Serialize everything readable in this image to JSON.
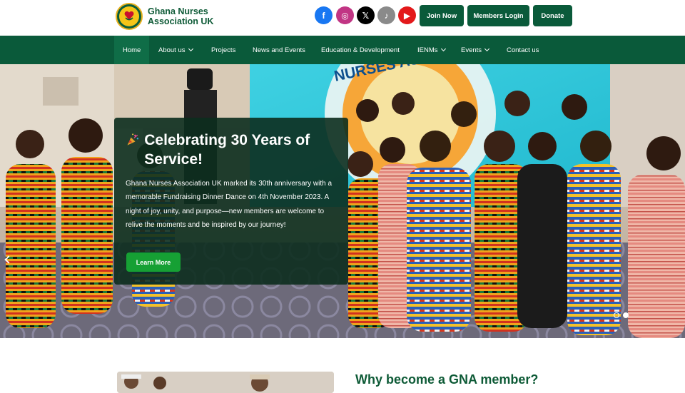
{
  "brand": {
    "line1": "Ghana Nurses",
    "line2": "Association UK",
    "color": "#0d5a36"
  },
  "social": [
    {
      "name": "facebook-icon",
      "glyph": "f",
      "color": "#1877f2"
    },
    {
      "name": "instagram-icon",
      "glyph": "◎",
      "color": "#c13584"
    },
    {
      "name": "x-icon",
      "glyph": "𝕏",
      "color": "#000000"
    },
    {
      "name": "tiktok-icon",
      "glyph": "♪",
      "color": "#8a8a8a"
    },
    {
      "name": "youtube-icon",
      "glyph": "▶",
      "color": "#e3191b"
    }
  ],
  "header_buttons": {
    "join": "Join Now",
    "login": "Members Login",
    "donate": "Donate"
  },
  "nav": [
    {
      "label": "Home",
      "dropdown": false,
      "active": true
    },
    {
      "label": "About us",
      "dropdown": true
    },
    {
      "label": "Projects",
      "dropdown": false
    },
    {
      "label": "News and Events",
      "dropdown": false
    },
    {
      "label": "Education & Development",
      "dropdown": false
    },
    {
      "label": "IENMs",
      "dropdown": true
    },
    {
      "label": "Events",
      "dropdown": true
    },
    {
      "label": "Contact us",
      "dropdown": false
    }
  ],
  "hero": {
    "banner_text": "NURSES ASSOCIATION",
    "title": "Celebrating 30 Years of Service!",
    "text": "Ghana Nurses Association UK marked its 30th anniversary with a memorable Fundraising Dinner Dance on 4th November 2023. A night of joy, unity, and purpose—new members are welcome to relive the moments and be inspired by our journey!",
    "button": "Learn More",
    "slides_count": 2,
    "active_slide": 2
  },
  "section": {
    "heading": "Why become a GNA member?"
  },
  "colors": {
    "primary": "#0a5a3a",
    "accent": "#16a034"
  }
}
